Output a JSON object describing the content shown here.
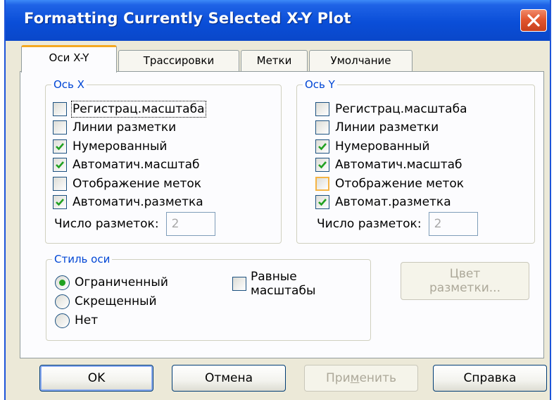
{
  "window": {
    "title": "Formatting Currently Selected X-Y Plot",
    "accent_color": "#0a4ed8",
    "close_icon": "close-icon"
  },
  "tabs": [
    {
      "label": "Оси X-Y",
      "active": true
    },
    {
      "label": "Трассировки",
      "active": false
    },
    {
      "label": "Метки",
      "active": false
    },
    {
      "label": "Умолчание",
      "active": false
    }
  ],
  "axis_x": {
    "title": "Ось X",
    "options": [
      {
        "label": "Регистрац.масштаба",
        "checked": false
      },
      {
        "label": "Линии разметки",
        "checked": false
      },
      {
        "label": "Нумерованный",
        "checked": true
      },
      {
        "label": "Автоматич.масштаб",
        "checked": true
      },
      {
        "label": "Отображение меток",
        "checked": false
      },
      {
        "label": "Автоматич.разметка",
        "checked": true
      }
    ],
    "count_label": "Число разметок:",
    "count_value": "2"
  },
  "axis_y": {
    "title": "Ось Y",
    "options": [
      {
        "label": "Регистрац.масштаба",
        "checked": false
      },
      {
        "label": "Линии разметки",
        "checked": false
      },
      {
        "label": "Нумерованный",
        "checked": true
      },
      {
        "label": "Автоматич.масштаб",
        "checked": true
      },
      {
        "label": "Отображение меток",
        "checked": false
      },
      {
        "label": "Автомат.разметка",
        "checked": true
      }
    ],
    "count_label": "Число разметок:",
    "count_value": "2"
  },
  "axis_style": {
    "title": "Стиль оси",
    "options": [
      {
        "label": "Ограниченный",
        "selected": true
      },
      {
        "label": "Скрещенный",
        "selected": false
      },
      {
        "label": "Нет",
        "selected": false
      }
    ],
    "equal_scales_line1": "Равные",
    "equal_scales_line2": "масштабы",
    "equal_scales_checked": false
  },
  "grid_color_button": {
    "line1": "Цвет",
    "line2": "разметки...",
    "enabled": false
  },
  "buttons": {
    "ok": "OK",
    "cancel": "Отмена",
    "apply_prefix": "При",
    "apply_underlined": "м",
    "apply_suffix": "енить",
    "help": "Справка"
  }
}
